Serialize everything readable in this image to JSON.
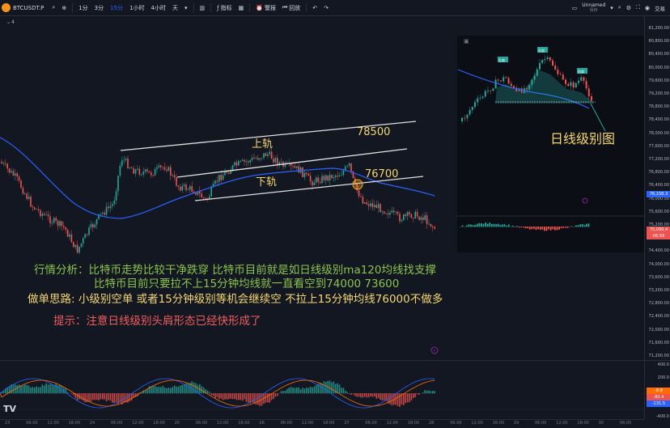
{
  "topbar": {
    "symbol": "BTCUSDT.P",
    "intervals": [
      "1分",
      "3分",
      "15分",
      "1小时",
      "4小时",
      "天"
    ],
    "active_interval": "15分",
    "indicators_label": "指标",
    "alert_label": "警报",
    "replay_label": "回放",
    "layout_name": "Unnamed",
    "layout_sub": "保存",
    "trade_label": "交易"
  },
  "legend_marker": "4",
  "chart_labels": {
    "upper_rail": "上轨",
    "lower_rail": "下轨",
    "price_78500": "78500",
    "price_76700": "76700",
    "daily_chart": "日线级别图"
  },
  "analysis": {
    "line1": "行情分析：比特币走势比较干净跌穿  比特币目前就是如日线级别ma120均线找支撑",
    "line2": "比特币目前只要拉不上15分钟均线就一直看空到74000   73600",
    "line3": "做单思路:   小级别空单  或者15分钟级别等机会继续空    不拉上15分钟均线76000不做多",
    "tip": "提示：注意日线级别头肩形态已经快形成了"
  },
  "inset": {
    "head_label": "头部",
    "left_shoulder": "左肩",
    "right_shoulder": "右肩"
  },
  "price_axis": [
    "81,200.00",
    "80,800.00",
    "80,400.00",
    "80,000.00",
    "79,600.00",
    "79,200.00",
    "78,800.00",
    "78,400.00",
    "78,000.00",
    "77,600.00",
    "77,200.00",
    "76,800.00",
    "76,400.00",
    "76,000.00",
    "75,600.00",
    "75,200.00",
    "74,800.00",
    "74,400.00",
    "74,000.00",
    "73,600.00",
    "73,200.00",
    "72,800.00",
    "72,400.00",
    "72,000.00",
    "71,600.00",
    "71,200.00"
  ],
  "price_badges": {
    "ma": "76,158.3",
    "last": "75,099.4",
    "countdown": "06:59"
  },
  "macd_axis": [
    "400.0",
    "200.0",
    "0.0",
    "-200.0",
    "-400.0"
  ],
  "macd_badges": [
    "-8.9",
    "-82.4",
    "-131.5"
  ],
  "time_axis": [
    "23",
    "06:00",
    "12:00",
    "18:00",
    "24",
    "06:00",
    "12:00",
    "18:00",
    "25",
    "06:00",
    "12:00",
    "18:00",
    "26",
    "06:00",
    "12:00",
    "18:00",
    "27",
    "06:00",
    "12:00",
    "18:00",
    "28",
    "06:00",
    "12:00",
    "18:00",
    "29",
    "06:00",
    "12:00",
    "18:00",
    "30",
    "06:00"
  ],
  "colors": {
    "background": "#131722",
    "up": "#26a69a",
    "down": "#ef5350",
    "ma_blue": "#2962ff",
    "text_green": "#8bc34a",
    "text_yellow": "#f5d76e",
    "text_red": "#f05e5e"
  }
}
